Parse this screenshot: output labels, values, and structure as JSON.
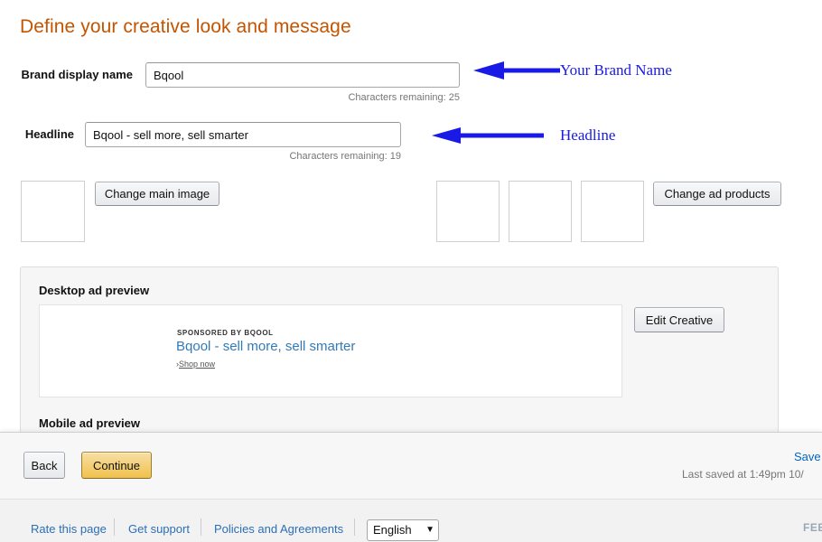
{
  "page": {
    "title": "Define your creative look and message"
  },
  "form": {
    "brand": {
      "label": "Brand display name",
      "value": "Bqool",
      "placeholder": "Brand display name",
      "chars_remaining": "Characters remaining: 25"
    },
    "headline": {
      "label": "Headline",
      "value": "Bqool - sell more, sell smarter",
      "placeholder": "Headline",
      "chars_remaining": "Characters remaining: 19"
    }
  },
  "media": {
    "change_main_image_label": "Change main image",
    "change_ad_products_label": "Change ad products",
    "main_image_alt": "main-image-thumbnail",
    "product_thumbs": [
      "product-thumbnail-1",
      "product-thumbnail-2",
      "product-thumbnail-3"
    ]
  },
  "preview": {
    "desktop_heading": "Desktop ad preview",
    "mobile_heading": "Mobile ad preview",
    "edit_creative_label": "Edit Creative",
    "ad": {
      "sponsored_by": "SPONSORED BY BQOOL",
      "headline": "Bqool - sell more, sell smarter",
      "cta_chevron": "›",
      "cta": "Shop now"
    }
  },
  "annotations": [
    {
      "text": "Your Brand Name",
      "name": "annotation-brand-name"
    },
    {
      "text": "Headline",
      "name": "annotation-headline"
    }
  ],
  "bottom_bar": {
    "back_label": "Back",
    "continue_label": "Continue",
    "save_label": "Save",
    "last_saved": "Last saved at 1:49pm 10/"
  },
  "footer": {
    "links": [
      {
        "label": "Rate this page"
      },
      {
        "label": "Get support"
      },
      {
        "label": "Policies and Agreements"
      }
    ],
    "language": "English",
    "language_caret": "▼",
    "feedback_label": "FEE"
  },
  "colors": {
    "title_orange": "#c45500",
    "annotation_blue": "#1a1ae6",
    "link_blue": "#2b6fb6",
    "ad_headline_blue": "#337ab7",
    "gold_button": "#f0c14b"
  }
}
